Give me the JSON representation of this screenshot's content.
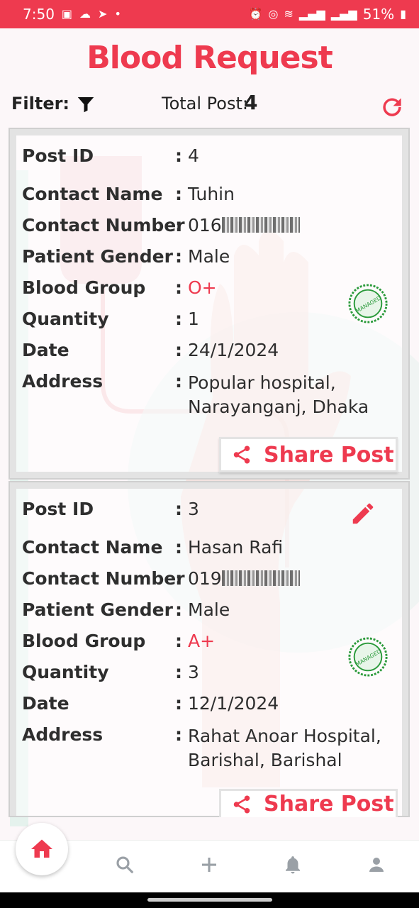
{
  "status_bar": {
    "time": "7:50",
    "battery": "51%"
  },
  "header": {
    "title": "Blood Request"
  },
  "toolbar": {
    "filter_label": "Filter:",
    "total_label": "Total Post:",
    "total_value": "4"
  },
  "posts": [
    {
      "labels": [
        "Post ID",
        "Contact Name",
        "Contact Number",
        "Patient Gender",
        "Blood Group",
        "Quantity",
        "Date",
        "Address"
      ],
      "post_id": "4",
      "contact_name": "Tuhin",
      "contact_number_prefix": "016",
      "patient_gender": "Male",
      "blood_group": "O+",
      "quantity": "1",
      "date": "24/1/2024",
      "address_line1": "Popular hospital,",
      "address_line2": "Narayanganj, Dhaka",
      "share_label": "Share Post",
      "stamp": "MANAGED"
    },
    {
      "labels": [
        "Post ID",
        "Contact Name",
        "Contact Number",
        "Patient Gender",
        "Blood Group",
        "Quantity",
        "Date",
        "Address"
      ],
      "post_id": "3",
      "contact_name": "Hasan Rafi",
      "contact_number_prefix": "019",
      "patient_gender": "Male",
      "blood_group": "A+",
      "quantity": "3",
      "date": "12/1/2024",
      "address_line1": "Rahat Anoar Hospital,",
      "address_line2": "Barishal, Barishal",
      "share_label": "Share Post",
      "stamp": "MANAGED"
    }
  ],
  "colors": {
    "accent": "#ee3a4f",
    "stamp": "#2a9a3a"
  },
  "icons": [
    "filter-icon",
    "refresh-icon",
    "share-icon",
    "edit-icon",
    "home-icon",
    "search-icon",
    "add-icon",
    "bell-icon",
    "profile-icon"
  ]
}
